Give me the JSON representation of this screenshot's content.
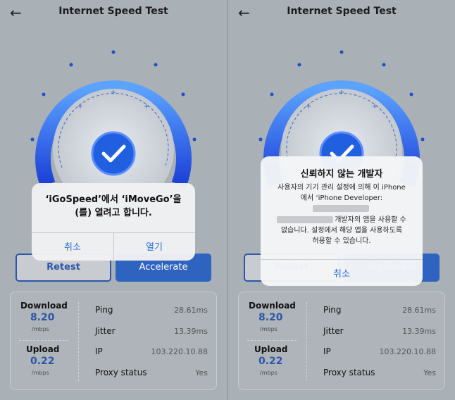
{
  "header": {
    "back_glyph": "←",
    "title": "Internet Speed Test"
  },
  "buttons": {
    "retest": "Retest",
    "accelerate": "Accelerate"
  },
  "stats": {
    "download_label": "Download",
    "download_value": "8.20",
    "download_unit": "/mbps",
    "upload_label": "Upload",
    "upload_value": "0.22",
    "upload_unit": "/mbps",
    "rows": [
      {
        "key": "Ping",
        "value": "28.61ms"
      },
      {
        "key": "Jitter",
        "value": "13.39ms"
      },
      {
        "key": "IP",
        "value": "103.220.10.88"
      },
      {
        "key": "Proxy status",
        "value": "Yes"
      }
    ]
  },
  "alert_open": {
    "line1": "‘iGoSpeed’에서 ‘iMoveGo’을",
    "line2": "(를) 열려고 합니다.",
    "cancel": "취소",
    "open": "열기"
  },
  "alert_untrusted": {
    "title": "신뢰하지 않는 개발자",
    "line1": "사용자의 기기 관리 설정에 의해 이 iPhone",
    "line2": "에서 ‘iPhone Developer:",
    "line3": "개발자의 앱을 사용할 수",
    "line4": "없습니다. 설정에서 해당 앱을 사용하도록",
    "line5": "허용할 수 있습니다.",
    "cancel": "취소"
  },
  "colors": {
    "accent": "#2e63c0",
    "alert_button": "#2f6fd6",
    "gauge_blue": "#1f5fe0"
  },
  "icons": [
    "back-arrow-icon",
    "checkmark-icon"
  ]
}
